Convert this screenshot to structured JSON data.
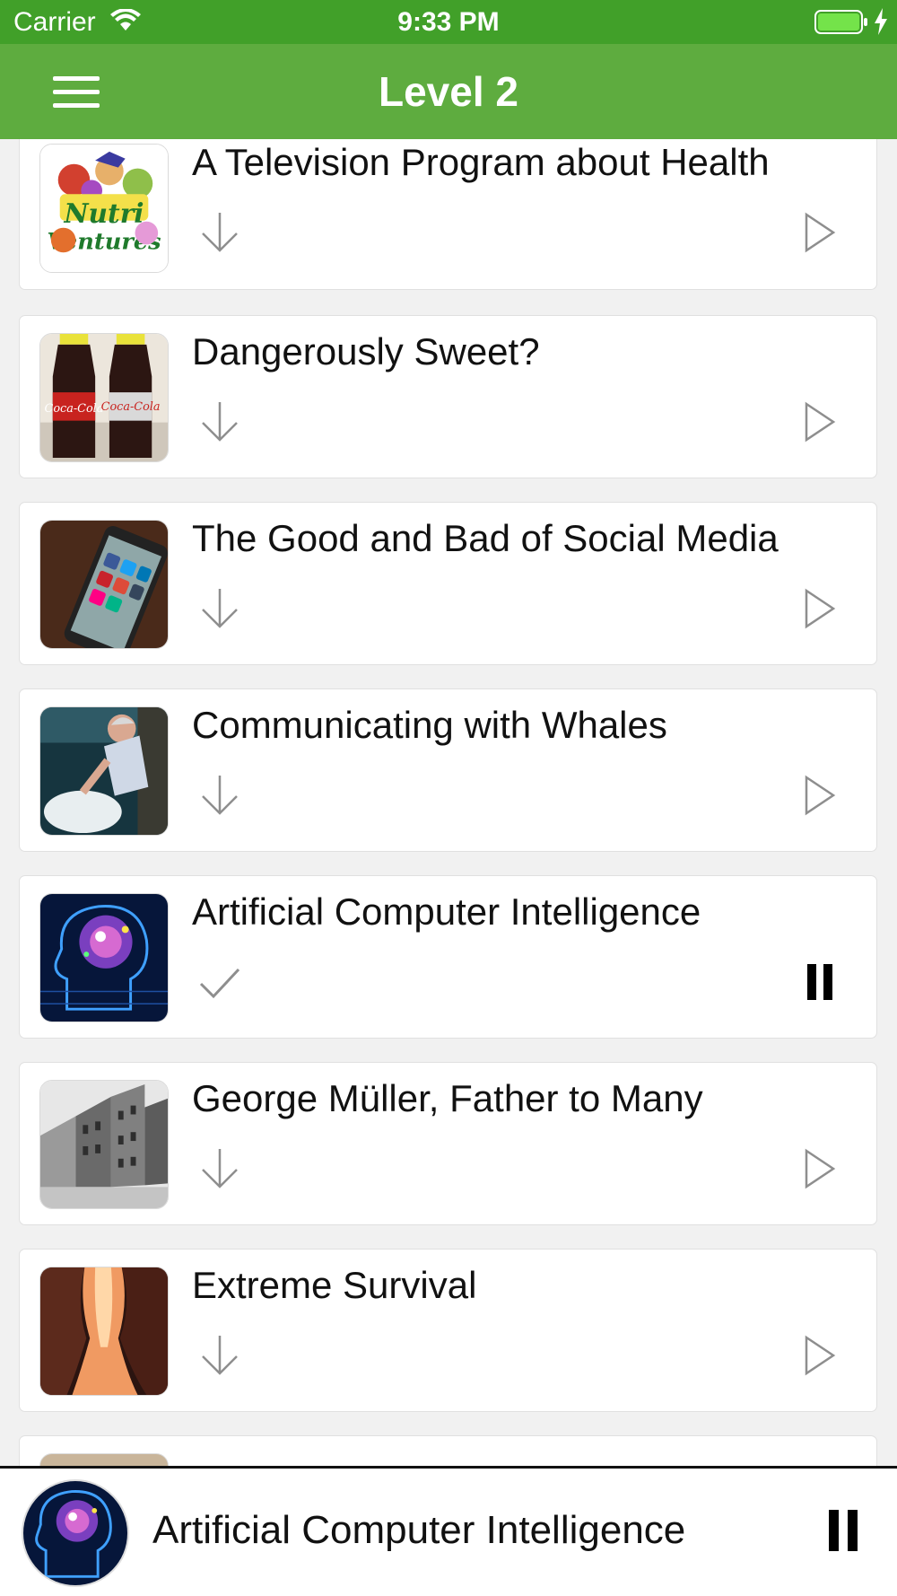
{
  "status_bar": {
    "carrier": "Carrier",
    "time": "9:33 PM",
    "icons": [
      "wifi-icon",
      "battery-icon",
      "charging-bolt-icon"
    ],
    "accent_color": "#41a029"
  },
  "nav": {
    "title": "Level 2",
    "menu_icon": "hamburger-menu-icon",
    "background_color": "#5eac3f"
  },
  "lessons": [
    {
      "title": "A Television Program about Health",
      "thumbnail": "nutri-ventures-cartoon",
      "download_state": "download",
      "playback_state": "play"
    },
    {
      "title": "Dangerously Sweet?",
      "thumbnail": "cola-bottles",
      "download_state": "download",
      "playback_state": "play"
    },
    {
      "title": "The Good and Bad of Social Media",
      "thumbnail": "social-media-phone",
      "download_state": "download",
      "playback_state": "play"
    },
    {
      "title": "Communicating with Whales",
      "thumbnail": "man-with-beluga-whale",
      "download_state": "download",
      "playback_state": "play"
    },
    {
      "title": "Artificial Computer Intelligence",
      "thumbnail": "digital-brain-head",
      "download_state": "downloaded",
      "playback_state": "pause"
    },
    {
      "title": "George Müller, Father to Many",
      "thumbnail": "old-orphanage-buildings",
      "download_state": "download",
      "playback_state": "play"
    },
    {
      "title": "Extreme Survival",
      "thumbnail": "slot-canyon",
      "download_state": "download",
      "playback_state": "play"
    }
  ],
  "now_playing": {
    "title": "Artificial Computer Intelligence",
    "artwork": "digital-brain-head",
    "control": "pause"
  }
}
